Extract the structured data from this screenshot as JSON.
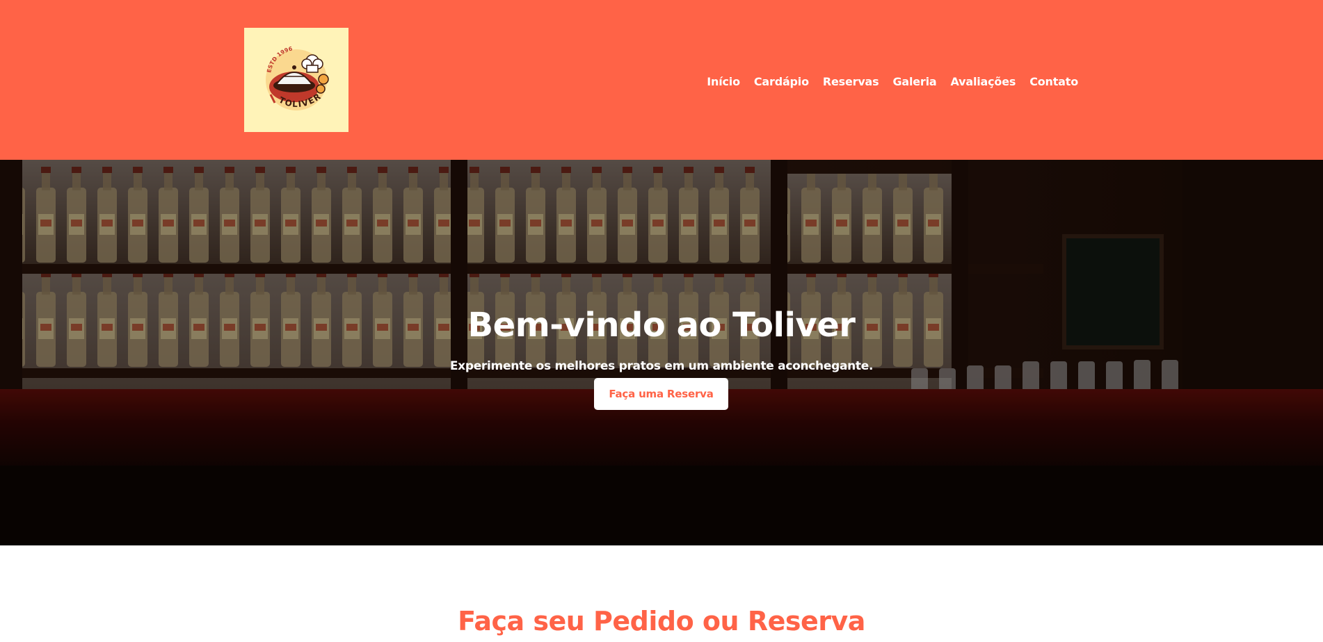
{
  "header": {
    "logo": {
      "top_text": "ESTD 1996",
      "name": "TOLIVER"
    },
    "nav": [
      {
        "label": "Início"
      },
      {
        "label": "Cardápio"
      },
      {
        "label": "Reservas"
      },
      {
        "label": "Galeria"
      },
      {
        "label": "Avaliações"
      },
      {
        "label": "Contato"
      }
    ]
  },
  "hero": {
    "title": "Bem-vindo ao Toliver",
    "subtitle": "Experimente os melhores pratos em um ambiente aconchegante.",
    "cta_label": "Faça uma Reserva"
  },
  "section": {
    "title": "Faça seu Pedido ou Reserva"
  },
  "colors": {
    "brand": "#ff6347",
    "logo_bg": "#fff3b8",
    "text_light": "#ffffff"
  }
}
